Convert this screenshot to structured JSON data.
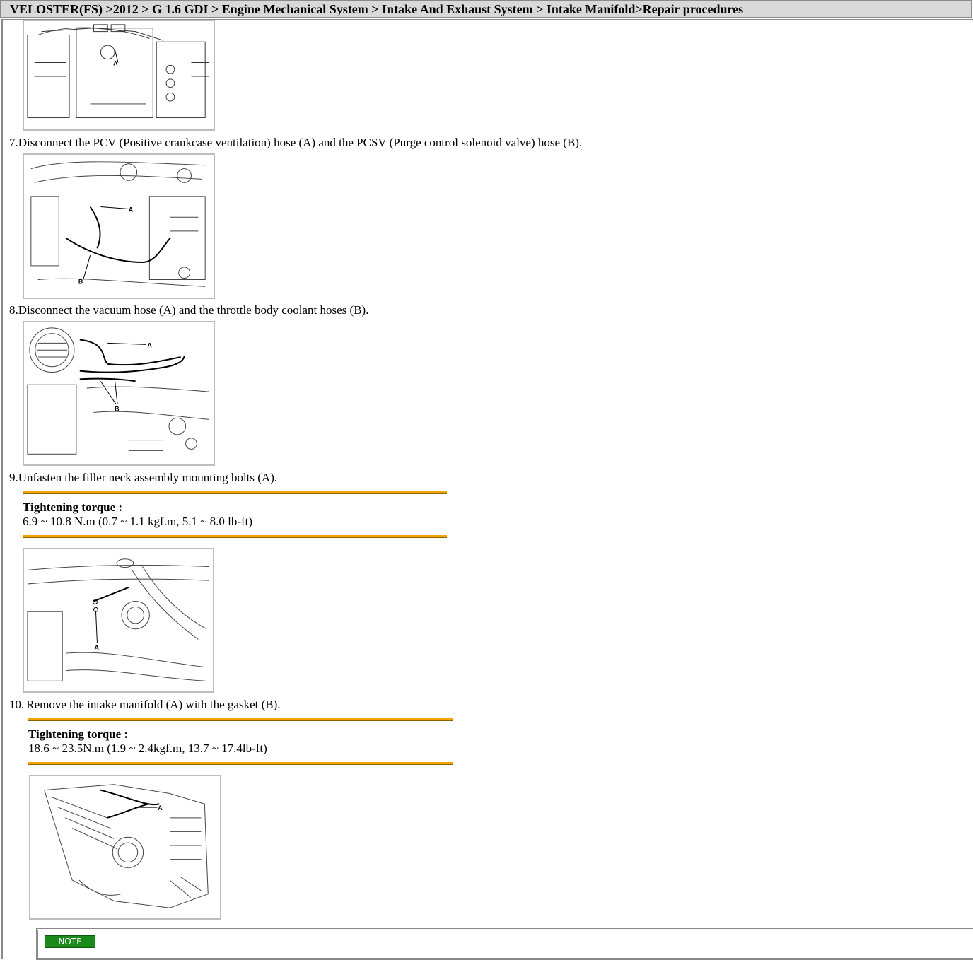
{
  "breadcrumb": "VELOSTER(FS) >2012 > G 1.6 GDI > Engine Mechanical System > Intake And Exhaust System > Intake Manifold>Repair procedures",
  "steps": [
    {
      "num": "7.",
      "text": "Disconnect the PCV (Positive crankcase ventilation) hose (A) and the PCSV (Purge control solenoid valve) hose (B)."
    },
    {
      "num": "8.",
      "text": "Disconnect the vacuum hose (A) and the throttle body coolant hoses (B)."
    },
    {
      "num": "9.",
      "text": "Unfasten the filler neck assembly mounting bolts (A)."
    },
    {
      "num": "10.",
      "text": "Remove the intake manifold (A) with the gasket (B)."
    }
  ],
  "torque": [
    {
      "label": "Tightening torque :",
      "value": "6.9 ~ 10.8 N.m (0.7 ~ 1.1 kgf.m, 5.1 ~ 8.0 lb-ft)"
    },
    {
      "label": "Tightening torque :",
      "value": "18.6 ~ 23.5N.m (1.9 ~ 2.4kgf.m, 13.7 ~ 17.4lb-ft)"
    }
  ],
  "figure_labels": {
    "fig0": [
      "A"
    ],
    "fig1": [
      "A",
      "B"
    ],
    "fig2": [
      "A",
      "B"
    ],
    "fig3": [
      "A"
    ],
    "fig4": [
      "A"
    ]
  },
  "note": {
    "label": "NOTE"
  },
  "colors": {
    "rule": "#f5a400",
    "note_badge": "#1b8a1b",
    "header_bg": "#d9d9d9"
  }
}
